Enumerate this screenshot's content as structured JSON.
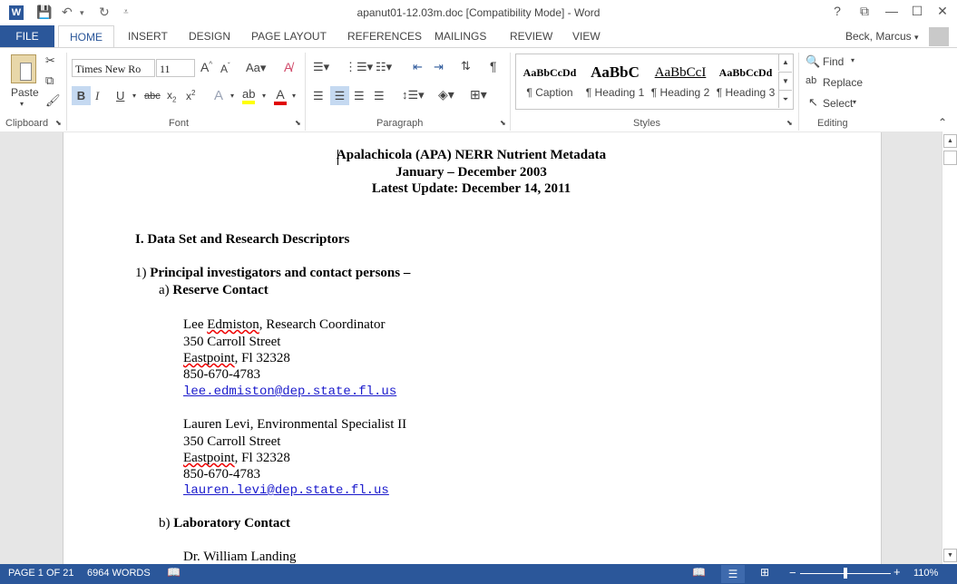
{
  "window": {
    "title": "apanut01-12.03m.doc [Compatibility Mode] - Word",
    "controls": [
      "?",
      "⧉",
      "—",
      "☐",
      "✕"
    ]
  },
  "ribbon_tabs": [
    "FILE",
    "HOME",
    "INSERT",
    "DESIGN",
    "PAGE LAYOUT",
    "REFERENCES",
    "MAILINGS",
    "REVIEW",
    "VIEW"
  ],
  "user": "Beck, Marcus",
  "clipboard": {
    "paste": "Paste",
    "label": "Clipboard"
  },
  "font": {
    "name": "Times New Ro",
    "size": "11",
    "label": "Font"
  },
  "paragraph": {
    "label": "Paragraph"
  },
  "styles": {
    "label": "Styles",
    "items": [
      {
        "preview": "AaBbCcDd",
        "name": "¶ Caption"
      },
      {
        "preview": "AaBbC",
        "name": "¶ Heading 1"
      },
      {
        "preview": "AaBbCcI",
        "name": "¶ Heading 2"
      },
      {
        "preview": "AaBbCcDd",
        "name": "¶ Heading 3"
      }
    ]
  },
  "editing": {
    "find": "Find",
    "replace": "Replace",
    "select": "Select",
    "label": "Editing"
  },
  "document": {
    "title1": "Apalachicola (APA) NERR Nutrient Metadata",
    "title2": "January – December 2003",
    "title3": "Latest Update: December 14, 2011",
    "section": "I. Data Set and Research Descriptors",
    "item1_prefix": "1) ",
    "item1": "Principal investigators and contact persons –",
    "sub_a_prefix": "a) ",
    "sub_a": "Reserve Contact",
    "contact1": {
      "first": "Lee ",
      "last": "Edmiston",
      "role": ", Research Coordinator",
      "street": "350 Carroll Street",
      "city": "Eastpoint",
      "state": ", Fl 32328",
      "phone": "850-670-4783",
      "email": "lee.edmiston@dep.state.fl.us"
    },
    "contact2": {
      "name": "Lauren Levi, Environmental Specialist II",
      "street": "350 Carroll Street",
      "city": "Eastpoint",
      "state": ", Fl 32328",
      "phone": "850-670-4783",
      "email": "lauren.levi@dep.state.fl.us"
    },
    "sub_b_prefix": "b) ",
    "sub_b": "Laboratory Contact",
    "contact3": "Dr. William Landing"
  },
  "status": {
    "page": "PAGE 1 OF 21",
    "words": "6964 WORDS",
    "zoom": "110%"
  }
}
